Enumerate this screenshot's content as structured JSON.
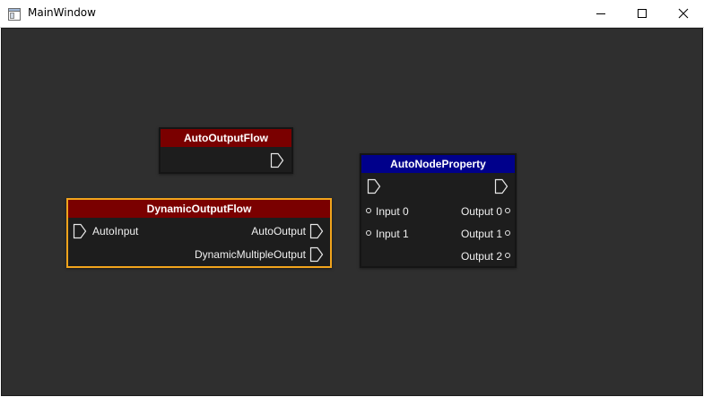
{
  "window": {
    "title": "MainWindow",
    "icon": "window-app-icon",
    "controls": [
      "minimize-icon",
      "maximize-icon",
      "close-icon"
    ]
  },
  "colors": {
    "canvas": "#2f2f2f",
    "node_body": "#1d1d1d",
    "flow_header": "#7a0000",
    "property_header": "#00008b",
    "selection": "#f2a41c"
  },
  "nodes": {
    "auto_output_flow": {
      "title": "AutoOutputFlow",
      "flow_out_icon": "flow-arrow-icon"
    },
    "dynamic_output_flow": {
      "title": "DynamicOutputFlow",
      "input": "AutoInput",
      "output_1": "AutoOutput",
      "output_2": "DynamicMultipleOutput",
      "selected": true
    },
    "auto_node_property": {
      "title": "AutoNodeProperty",
      "inputs": [
        "Input 0",
        "Input 1"
      ],
      "outputs": [
        "Output 0",
        "Output 1",
        "Output 2"
      ]
    }
  }
}
